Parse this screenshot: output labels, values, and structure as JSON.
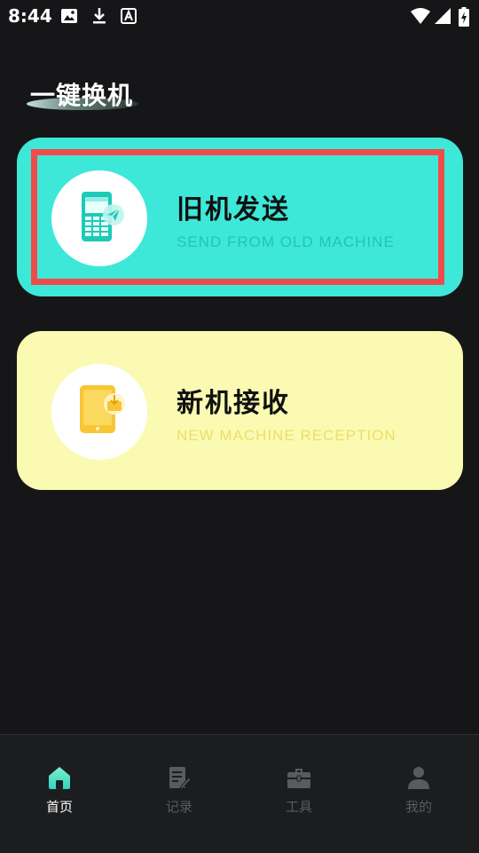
{
  "status_bar": {
    "time": "8:44"
  },
  "page": {
    "title": "一键换机"
  },
  "cards": {
    "send": {
      "title": "旧机发送",
      "subtitle": "SEND FROM OLD MACHINE"
    },
    "receive": {
      "title": "新机接收",
      "subtitle": "NEW MACHINE RECEPTION"
    }
  },
  "bottom_nav": {
    "items": [
      {
        "label": "首页",
        "icon": "home-icon",
        "active": true
      },
      {
        "label": "记录",
        "icon": "records-icon",
        "active": false
      },
      {
        "label": "工具",
        "icon": "toolbox-icon",
        "active": false
      },
      {
        "label": "我的",
        "icon": "profile-icon",
        "active": false
      }
    ]
  },
  "colors": {
    "background": "#161618",
    "send_card": "#3de8d8",
    "receive_card": "#fbfab2",
    "highlight": "#f04b4b",
    "active_nav": "#3fe6c8"
  }
}
